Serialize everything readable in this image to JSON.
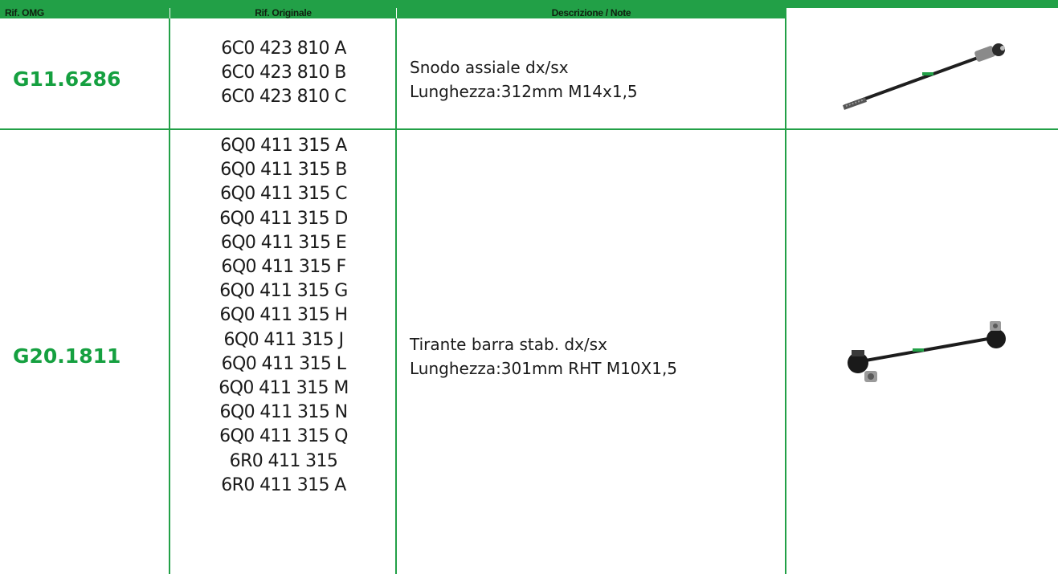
{
  "header": {
    "col_omg": "Rif. OMG",
    "col_original": "Rif. Originale",
    "col_desc": "Descrizione / Note"
  },
  "rows": [
    {
      "code": "G11.6286",
      "refs": [
        "6C0 423 810 A",
        "6C0 423 810 B",
        "6C0 423 810 C"
      ],
      "desc_line1": "Snodo assiale dx/sx",
      "desc_line2": "Lunghezza:312mm M14x1,5",
      "image_name": "tie-rod-axial-joint-image"
    },
    {
      "code": "G20.1811",
      "refs": [
        "6Q0 411 315 A",
        "6Q0 411 315 B",
        "6Q0 411 315 C",
        "6Q0 411 315 D",
        "6Q0 411 315 E",
        "6Q0 411 315 F",
        "6Q0 411 315 G",
        "6Q0 411 315 H",
        "6Q0 411 315 J",
        "6Q0 411 315 L",
        "6Q0 411 315 M",
        "6Q0 411 315 N",
        "6Q0 411 315 Q",
        "6R0 411 315",
        "6R0 411 315 A"
      ],
      "desc_line1": "Tirante barra stab. dx/sx",
      "desc_line2": "Lunghezza:301mm RHT M10X1,5",
      "image_name": "stabilizer-link-image"
    }
  ],
  "colors": {
    "brand_green": "#22a047",
    "code_green": "#15a040"
  }
}
